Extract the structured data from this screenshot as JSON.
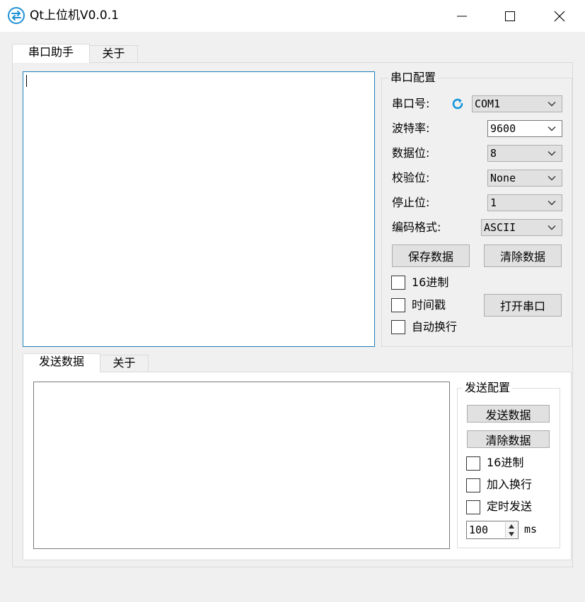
{
  "window": {
    "title": "Qt上位机V0.0.1",
    "icon": "serial-swap-icon",
    "controls": {
      "minimize": "minimize-icon",
      "maximize": "maximize-icon",
      "close": "close-icon"
    }
  },
  "top_tabs": [
    {
      "label": "串口助手",
      "active": true
    },
    {
      "label": "关于",
      "active": false
    }
  ],
  "serial_config": {
    "title": "串口配置",
    "port": {
      "label": "串口号:",
      "value": "COM1",
      "refresh_icon": "refresh-icon"
    },
    "baud": {
      "label": "波特率:",
      "value": "9600"
    },
    "data_bits": {
      "label": "数据位:",
      "value": "8"
    },
    "parity": {
      "label": "校验位:",
      "value": "None"
    },
    "stop_bits": {
      "label": "停止位:",
      "value": "1"
    },
    "encoding": {
      "label": "编码格式:",
      "value": "ASCII"
    },
    "save_button": "保存数据",
    "clear_button": "清除数据",
    "hex_checkbox": "16进制",
    "timestamp_checkbox": "时间戳",
    "autowrap_checkbox": "自动换行",
    "open_button": "打开串口"
  },
  "bottom_tabs": [
    {
      "label": "发送数据",
      "active": true
    },
    {
      "label": "关于",
      "active": false
    }
  ],
  "send_config": {
    "title": "发送配置",
    "send_button": "发送数据",
    "clear_button": "清除数据",
    "hex_checkbox": "16进制",
    "newline_checkbox": "加入换行",
    "timed_checkbox": "定时发送",
    "interval_value": "100",
    "interval_unit": "ms"
  },
  "colors": {
    "accent": "#1e7fb8",
    "refresh": "#1296db",
    "window_bg": "#f0f0f0"
  }
}
